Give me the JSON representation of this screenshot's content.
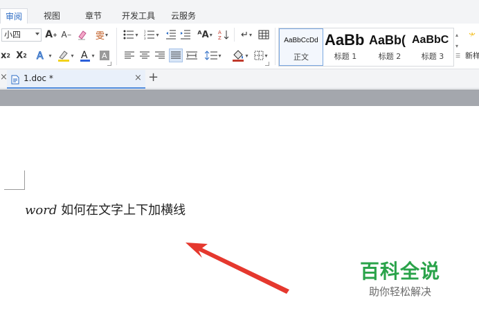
{
  "menu": {
    "tabs": [
      "审阅",
      "视图",
      "章节",
      "开发工具",
      "云服务"
    ],
    "active_tab": "审阅"
  },
  "ribbon": {
    "font_size_value": "小四",
    "styles": [
      {
        "sample": "AaBbCcDd",
        "name": "正文"
      },
      {
        "sample": "AaBb",
        "name": "标题 1"
      },
      {
        "sample": "AaBb(",
        "name": "标题 2"
      },
      {
        "sample": "AaBbC",
        "name": "标题 3"
      }
    ],
    "new_style_label": "新样",
    "colors": {
      "font_color": "#2b5fd9",
      "highlight": "#f2d21b",
      "shading": "#c0392b",
      "accent": "#2b6bc4"
    }
  },
  "document_tabs": {
    "tab_label": "1.doc *"
  },
  "document": {
    "word": "word",
    "text": " 如何在文字上下加横线"
  },
  "watermark": {
    "title": "百科全说",
    "subtitle": "助你轻松解决",
    "color": "#2aa34a"
  },
  "annotation": {
    "arrow_color": "#e5382e"
  }
}
